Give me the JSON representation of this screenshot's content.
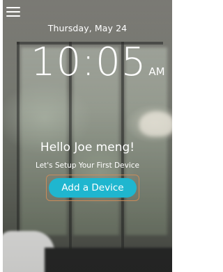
{
  "header": {
    "menu_icon": "hamburger-menu-icon",
    "date": "Thursday, May 24"
  },
  "clock": {
    "time": "10:05",
    "period": "AM"
  },
  "greeting": {
    "title": "Hello Joe meng!",
    "subtitle": "Let's Setup Your First Device"
  },
  "actions": {
    "add_device_label": "Add a Device"
  },
  "colors": {
    "accent": "#1fb6cf",
    "highlight_outline": "#c98b5a",
    "text": "#ffffff"
  }
}
